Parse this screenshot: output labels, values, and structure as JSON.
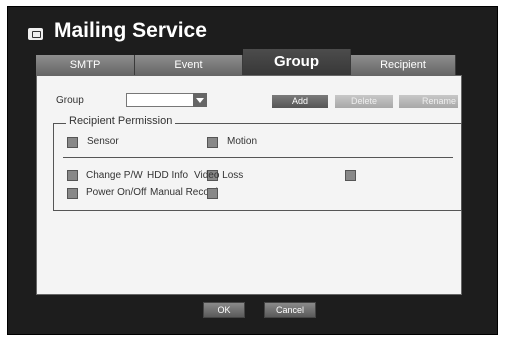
{
  "window": {
    "title": "Mailing Service"
  },
  "tabs": [
    {
      "label": "SMTP"
    },
    {
      "label": "Event"
    },
    {
      "label": "Group",
      "active": true
    },
    {
      "label": "Recipient"
    }
  ],
  "group": {
    "label": "Group",
    "selected_value": "",
    "add_label": "Add",
    "delete_label": "Delete",
    "rename_label": "Rename"
  },
  "permission": {
    "legend": "Recipient Permission",
    "items": [
      {
        "label": "Sensor"
      },
      {
        "label": "Motion"
      },
      {
        "label": "Change P/W"
      },
      {
        "label": "HDD Info"
      },
      {
        "label": "Video Loss"
      },
      {
        "label": "Power On/Off"
      },
      {
        "label": "Manual Record"
      }
    ]
  },
  "footer": {
    "ok_label": "OK",
    "cancel_label": "Cancel"
  },
  "icons": {
    "title": "mail-icon",
    "dropdown": "chevron-down-icon"
  }
}
